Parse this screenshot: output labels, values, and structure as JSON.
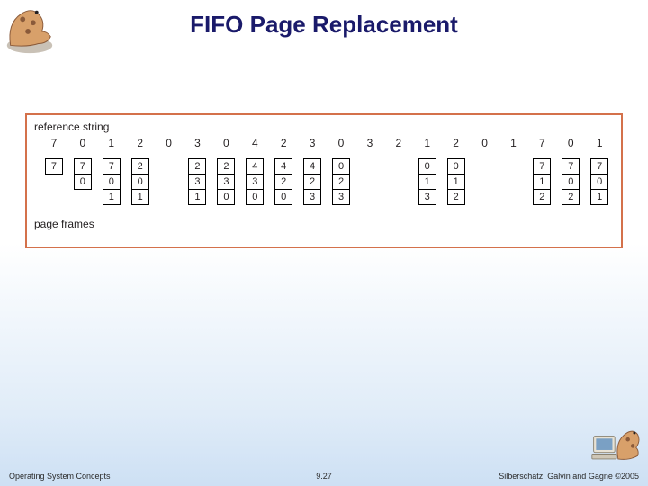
{
  "title": "FIFO Page Replacement",
  "figure": {
    "ref_label": "reference string",
    "pf_label": "page frames",
    "reference": [
      "7",
      "0",
      "1",
      "2",
      "0",
      "3",
      "0",
      "4",
      "2",
      "3",
      "0",
      "3",
      "2",
      "1",
      "2",
      "0",
      "1",
      "7",
      "0",
      "1"
    ],
    "frames": [
      [
        "7"
      ],
      [
        "7",
        "0"
      ],
      [
        "7",
        "0",
        "1"
      ],
      [
        "2",
        "0",
        "1"
      ],
      null,
      [
        "2",
        "3",
        "1"
      ],
      [
        "2",
        "3",
        "0"
      ],
      [
        "4",
        "3",
        "0"
      ],
      [
        "4",
        "2",
        "0"
      ],
      [
        "4",
        "2",
        "3"
      ],
      [
        "0",
        "2",
        "3"
      ],
      null,
      null,
      [
        "0",
        "1",
        "3"
      ],
      [
        "0",
        "1",
        "2"
      ],
      null,
      null,
      [
        "7",
        "1",
        "2"
      ],
      [
        "7",
        "0",
        "2"
      ],
      [
        "7",
        "0",
        "1"
      ]
    ]
  },
  "footer": {
    "left": "Operating System Concepts",
    "mid": "9.27",
    "right": "Silberschatz, Galvin and Gagne ©2005"
  },
  "colors": {
    "title": "#1a1a6a",
    "figure_border": "#d4714b",
    "mascot_body": "#d8a06a",
    "mascot_spots": "#8a5a3a"
  }
}
